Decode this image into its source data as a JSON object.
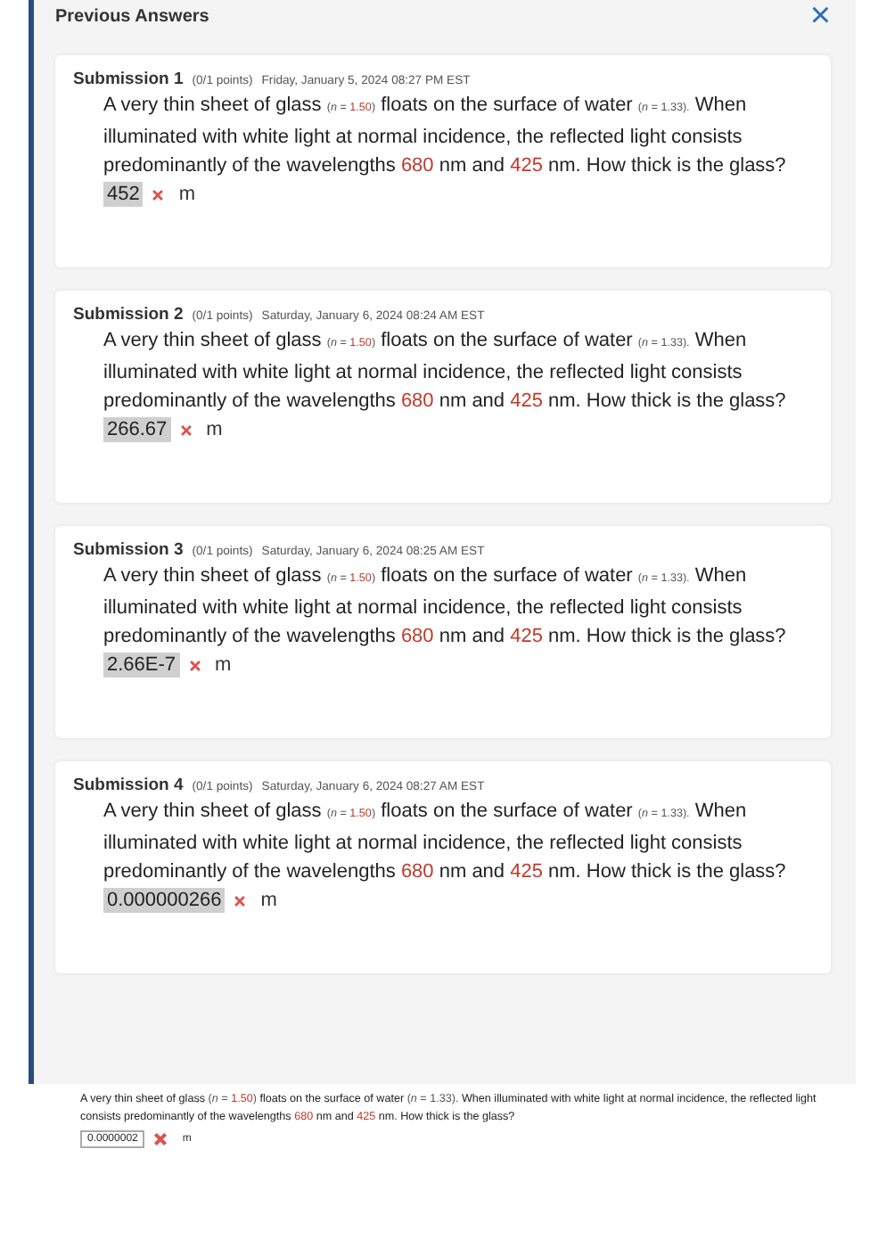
{
  "panel": {
    "title": "Previous Answers",
    "close": "×"
  },
  "submissions": [
    {
      "label": "Submission 1",
      "points": "(0/1 points)",
      "date": "Friday, January 5, 2024 08:27 PM EST",
      "question": [
        {
          "kind": "plain",
          "text": "A very thin sheet of glass "
        },
        {
          "kind": "note",
          "text": "(*n* = "
        },
        {
          "kind": "note_value",
          "text": "1.50"
        },
        {
          "kind": "note",
          "text": ")"
        },
        {
          "kind": "plain",
          "text": " floats on the surface of water "
        },
        {
          "kind": "note",
          "text": "(*n* = 1.33)."
        },
        {
          "kind": "plain",
          "text": " When illuminated with white light at normal incidence, the reflected light consists predominantly of the wavelengths "
        },
        {
          "kind": "value",
          "text": "680"
        },
        {
          "kind": "plain",
          "text": " nm and "
        },
        {
          "kind": "value",
          "text": "425"
        },
        {
          "kind": "plain",
          "text": " nm. How thick is the glass?"
        }
      ],
      "answer": "452",
      "correct": false,
      "unit": "m"
    },
    {
      "label": "Submission 2",
      "points": "(0/1 points)",
      "date": "Saturday, January 6, 2024 08:24 AM EST",
      "question": [
        {
          "kind": "plain",
          "text": "A very thin sheet of glass "
        },
        {
          "kind": "note",
          "text": "(*n* = "
        },
        {
          "kind": "note_value",
          "text": "1.50"
        },
        {
          "kind": "note",
          "text": ")"
        },
        {
          "kind": "plain",
          "text": " floats on the surface of water "
        },
        {
          "kind": "note",
          "text": "(*n* = 1.33)."
        },
        {
          "kind": "plain",
          "text": " When illuminated with white light at normal incidence, the reflected light consists predominantly of the wavelengths "
        },
        {
          "kind": "value",
          "text": "680"
        },
        {
          "kind": "plain",
          "text": " nm and "
        },
        {
          "kind": "value",
          "text": "425"
        },
        {
          "kind": "plain",
          "text": " nm. How thick is the glass?"
        }
      ],
      "answer": "266.67",
      "correct": false,
      "unit": "m"
    },
    {
      "label": "Submission 3",
      "points": "(0/1 points)",
      "date": "Saturday, January 6, 2024 08:25 AM EST",
      "question": [
        {
          "kind": "plain",
          "text": "A very thin sheet of glass "
        },
        {
          "kind": "note",
          "text": "(*n* = "
        },
        {
          "kind": "note_value",
          "text": "1.50"
        },
        {
          "kind": "note",
          "text": ")"
        },
        {
          "kind": "plain",
          "text": " floats on the surface of water "
        },
        {
          "kind": "note",
          "text": "(*n* = 1.33)."
        },
        {
          "kind": "plain",
          "text": " When illuminated with white light at normal incidence, the reflected light consists predominantly of the wavelengths "
        },
        {
          "kind": "value",
          "text": "680"
        },
        {
          "kind": "plain",
          "text": " nm and "
        },
        {
          "kind": "value",
          "text": "425"
        },
        {
          "kind": "plain",
          "text": " nm. How thick is the glass?"
        }
      ],
      "answer": "2.66E-7",
      "correct": false,
      "unit": "m"
    },
    {
      "label": "Submission 4",
      "points": "(0/1 points)",
      "date": "Saturday, January 6, 2024 08:27 AM EST",
      "question": [
        {
          "kind": "plain",
          "text": "A very thin sheet of glass "
        },
        {
          "kind": "note",
          "text": "(*n* = "
        },
        {
          "kind": "note_value",
          "text": "1.50"
        },
        {
          "kind": "note",
          "text": ")"
        },
        {
          "kind": "plain",
          "text": " floats on the surface of water "
        },
        {
          "kind": "note",
          "text": "(*n* = 1.33)."
        },
        {
          "kind": "plain",
          "text": " When illuminated with white light at normal incidence, the reflected light consists predominantly of the wavelengths "
        },
        {
          "kind": "value",
          "text": "680"
        },
        {
          "kind": "plain",
          "text": " nm and "
        },
        {
          "kind": "value",
          "text": "425"
        },
        {
          "kind": "plain",
          "text": " nm. How thick is the glass?"
        }
      ],
      "answer": "0.000000266",
      "correct": false,
      "unit": "m"
    }
  ],
  "current": {
    "question": [
      {
        "kind": "plain",
        "text": "A very thin sheet of glass "
      },
      {
        "kind": "note",
        "text": "(*n* = "
      },
      {
        "kind": "note_value",
        "text": "1.50"
      },
      {
        "kind": "note",
        "text": ")"
      },
      {
        "kind": "plain",
        "text": " floats on the surface of water "
      },
      {
        "kind": "note",
        "text": "(*n* = 1.33)."
      },
      {
        "kind": "plain",
        "text": " When illuminated with white light at normal incidence, the reflected light consists predominantly of the wavelengths "
      },
      {
        "kind": "value",
        "text": "680"
      },
      {
        "kind": "plain",
        "text": " nm and "
      },
      {
        "kind": "value",
        "text": "425"
      },
      {
        "kind": "plain",
        "text": " nm. How thick is the glass?"
      }
    ],
    "answer": "0.0000002",
    "correct": false,
    "unit": "m"
  }
}
